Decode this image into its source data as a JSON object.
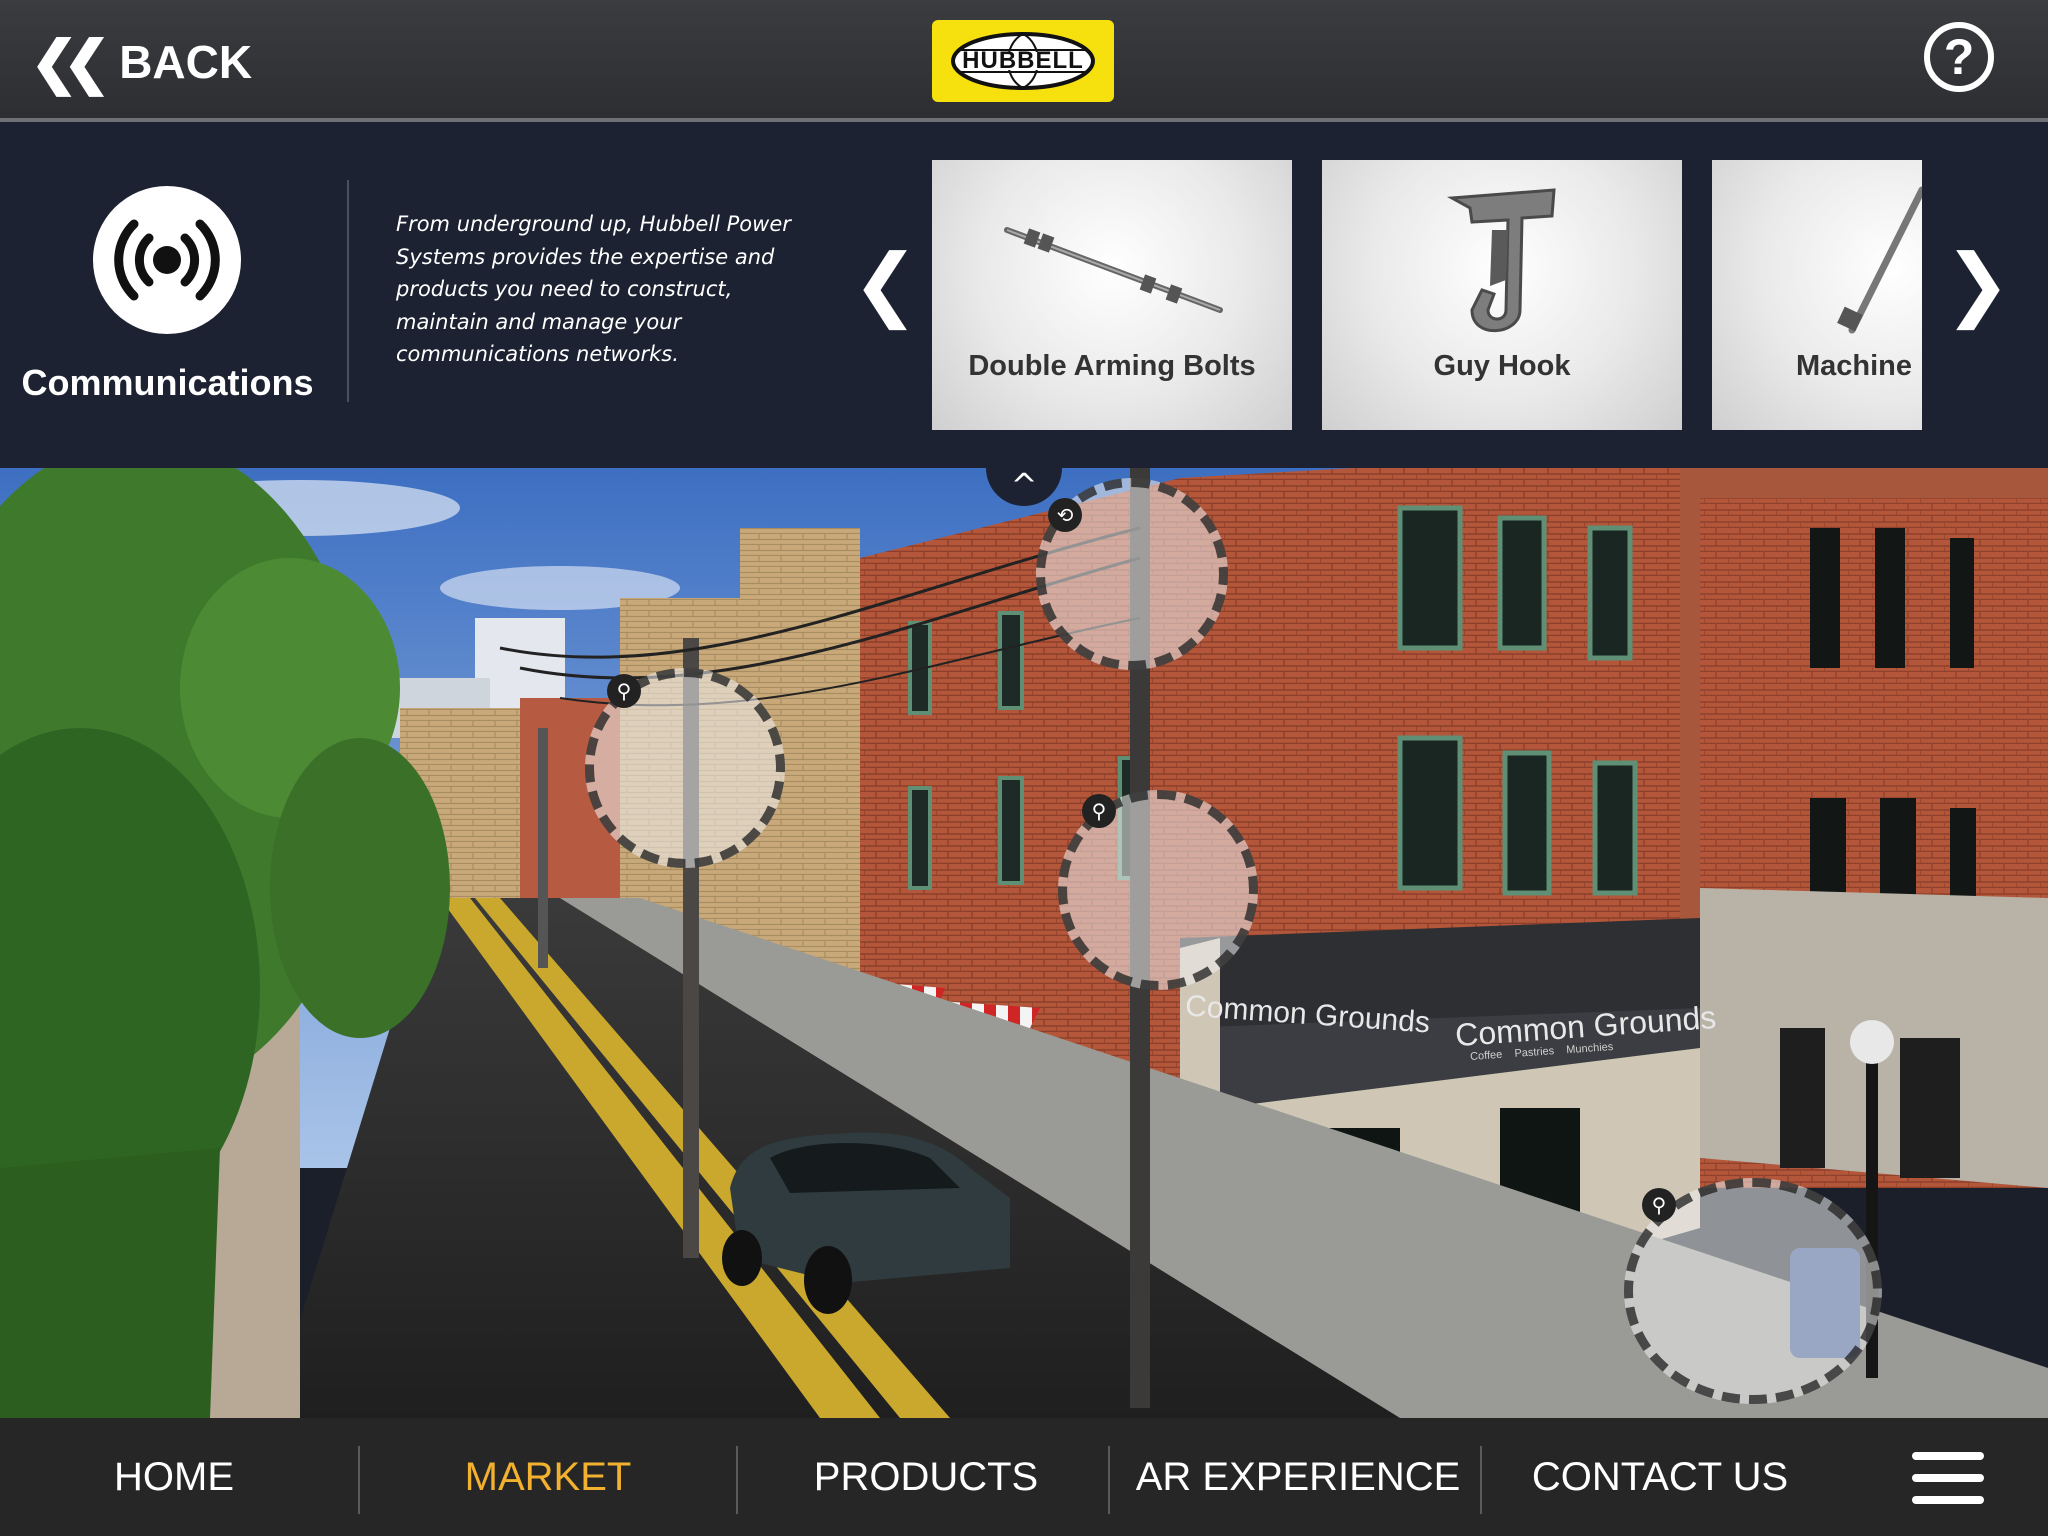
{
  "header": {
    "back_label": "BACK",
    "logo_text": "HUBBELL",
    "help_label": "?"
  },
  "market": {
    "icon": "broadcast-icon",
    "title": "Communications",
    "description": "From underground up, Hubbell Power Systems provides the expertise and products you need to construct, maintain and manage your communications networks."
  },
  "carousel": {
    "prev_label": "❮",
    "next_label": "❯",
    "products": [
      {
        "name": "Double Arming Bolts"
      },
      {
        "name": "Guy Hook"
      },
      {
        "name": "Machine"
      }
    ]
  },
  "scene": {
    "collapse_label": "^",
    "storefront_sign": "Common Grounds",
    "storefront_sign_small": "Coffee    Pastries    Munchies",
    "hotspots": [
      {
        "icon": "rotate-icon"
      },
      {
        "icon": "magnify-icon"
      },
      {
        "icon": "magnify-icon"
      },
      {
        "icon": "magnify-icon"
      }
    ]
  },
  "nav": {
    "items": [
      {
        "label": "HOME"
      },
      {
        "label": "MARKET"
      },
      {
        "label": "PRODUCTS"
      },
      {
        "label": "AR EXPERIENCE"
      },
      {
        "label": "CONTACT US"
      }
    ],
    "active": "MARKET",
    "menu_icon": "hamburger-menu-icon"
  },
  "colors": {
    "accent": "#f2b12e",
    "logo_yellow": "#f6e00e",
    "panel_bg": "#1c2231",
    "nav_bg": "#262626"
  }
}
